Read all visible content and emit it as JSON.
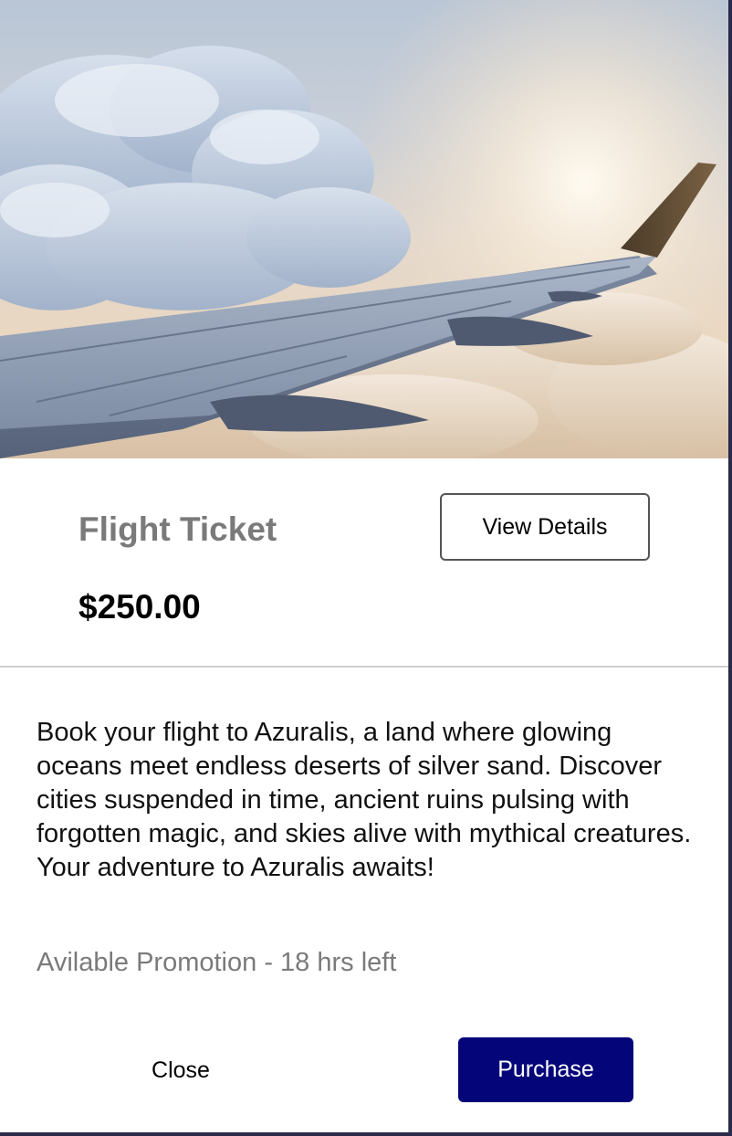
{
  "product": {
    "title": "Flight Ticket",
    "price": "$250.00",
    "view_details_label": "View Details"
  },
  "description": "Book your flight to Azuralis, a land where glowing oceans meet endless deserts of silver sand. Discover cities suspended in time, ancient ruins pulsing with forgotten magic, and skies alive with mythical creatures. Your adventure to Azuralis awaits!",
  "promotion": "Avilable Promotion - 18 hrs left",
  "actions": {
    "close_label": "Close",
    "purchase_label": "Purchase"
  },
  "colors": {
    "purchase_button": "#05057a",
    "muted_text": "#7a7a7a"
  }
}
